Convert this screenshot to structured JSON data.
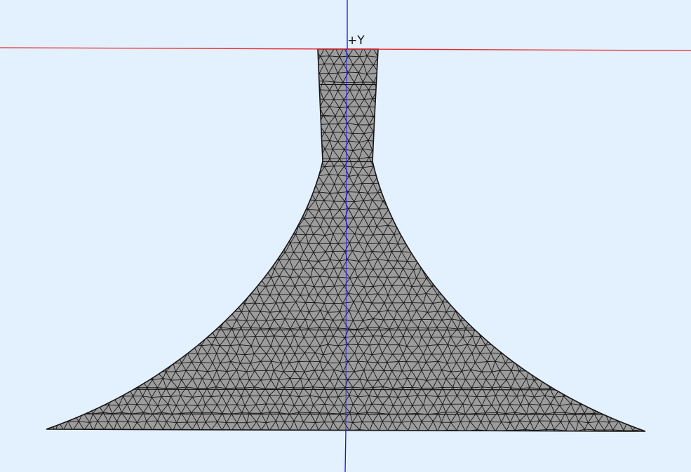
{
  "viewport": {
    "background": "#e3f0fe",
    "view": "front"
  },
  "axes": {
    "y_axis": {
      "label": "+Y",
      "color": "#1a10ee"
    },
    "x_axis": {
      "color": "#e8262d"
    }
  },
  "model": {
    "shape": "flared-horn-solid",
    "render_style": "shaded-with-wireframe",
    "mesh": "triangulated",
    "fill_color": "#9c9c9c",
    "edge_color": "#151515"
  }
}
